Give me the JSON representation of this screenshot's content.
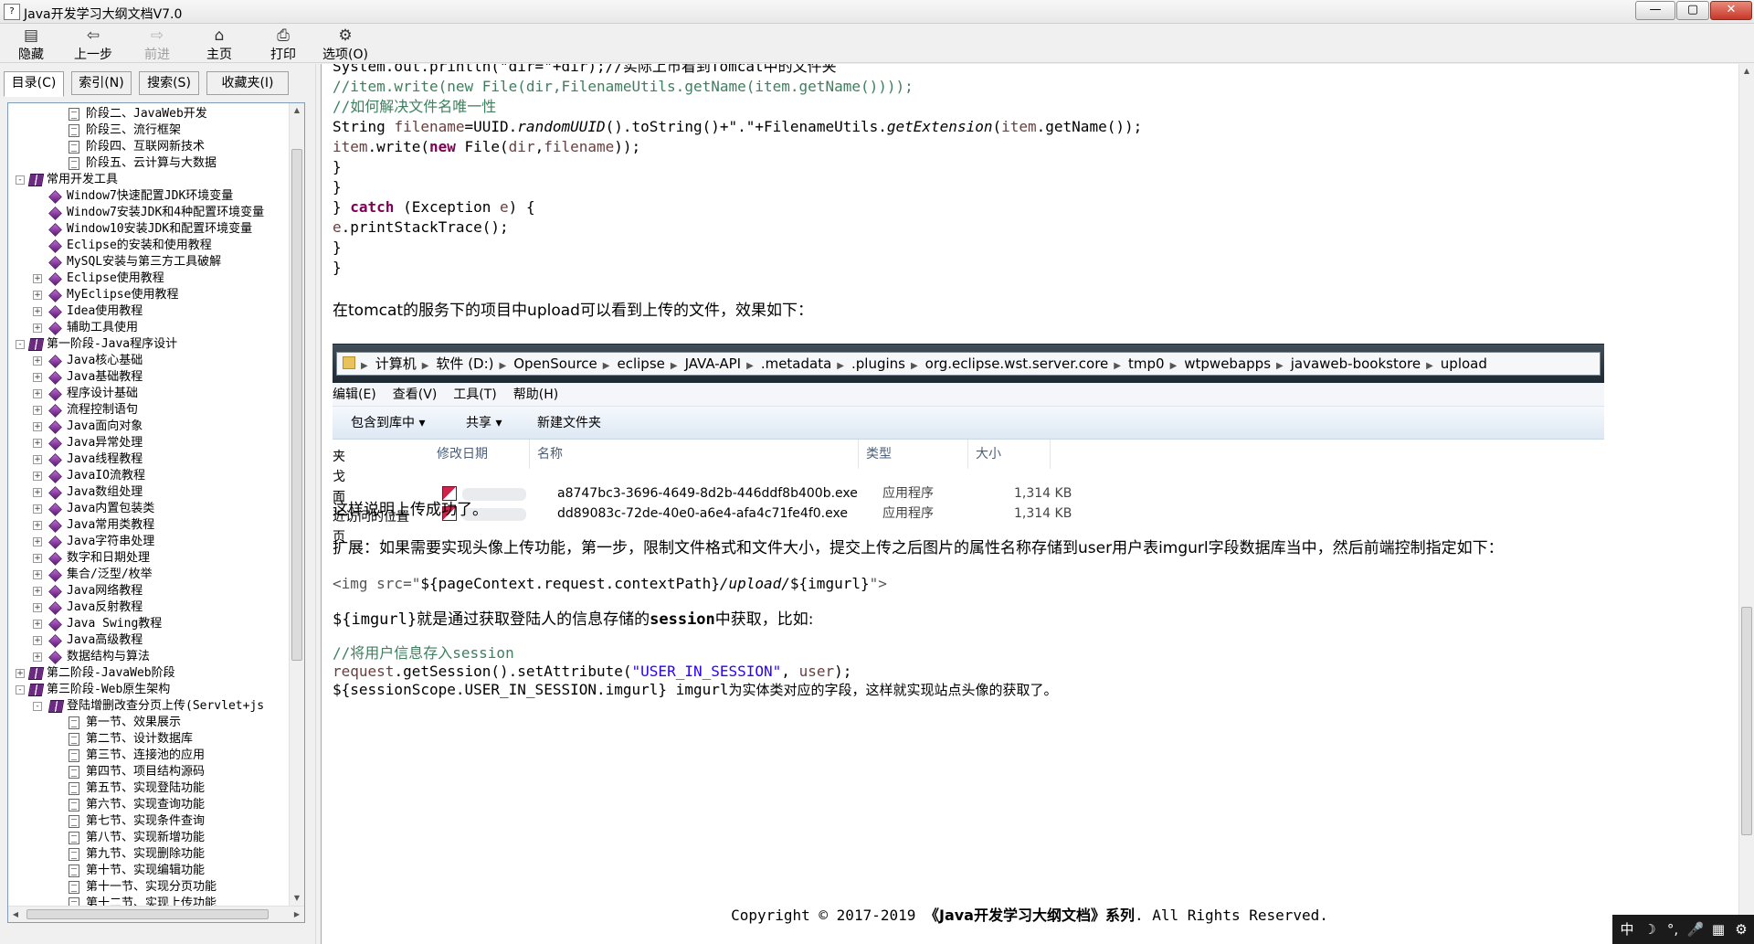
{
  "window": {
    "title": "Java开发学习大纲文档V7.0",
    "min": "—",
    "max": "▢",
    "close": "✕"
  },
  "toolbar": [
    {
      "label": "隐藏",
      "icon": "hide-icon",
      "glyph": "▤",
      "disabled": false
    },
    {
      "label": "上一步",
      "icon": "back-icon",
      "glyph": "⇦",
      "disabled": false
    },
    {
      "label": "前进",
      "icon": "forward-icon",
      "glyph": "⇨",
      "disabled": true
    },
    {
      "label": "主页",
      "icon": "home-icon",
      "glyph": "⌂",
      "disabled": false
    },
    {
      "label": "打印",
      "icon": "print-icon",
      "glyph": "⎙",
      "disabled": false
    },
    {
      "label": "选项(O)",
      "icon": "options-icon",
      "glyph": "⚙",
      "disabled": false
    }
  ],
  "tabs": [
    "目录(C)",
    "索引(N)",
    "搜索(S)",
    "收藏夹(I)"
  ],
  "tree": [
    {
      "level": 2,
      "icon": "doc",
      "label": "阶段二、JavaWeb开发"
    },
    {
      "level": 2,
      "icon": "doc",
      "label": "阶段三、流行框架"
    },
    {
      "level": 2,
      "icon": "doc",
      "label": "阶段四、互联网新技术"
    },
    {
      "level": 2,
      "icon": "doc",
      "label": "阶段五、云计算与大数据"
    },
    {
      "level": 0,
      "icon": "book",
      "expander": "-",
      "label": "常用开发工具"
    },
    {
      "level": 1,
      "icon": "gem",
      "label": "Window7快速配置JDK环境变量"
    },
    {
      "level": 1,
      "icon": "gem",
      "label": "Window7安装JDK和4种配置环境变量"
    },
    {
      "level": 1,
      "icon": "gem",
      "label": "Window10安装JDK和配置环境变量"
    },
    {
      "level": 1,
      "icon": "gem",
      "label": "Eclipse的安装和使用教程"
    },
    {
      "level": 1,
      "icon": "gem",
      "label": "MySQL安装与第三方工具破解"
    },
    {
      "level": 1,
      "icon": "gem",
      "expander": "+",
      "label": "Eclipse使用教程"
    },
    {
      "level": 1,
      "icon": "gem",
      "expander": "+",
      "label": "MyEclipse使用教程"
    },
    {
      "level": 1,
      "icon": "gem",
      "expander": "+",
      "label": "Idea使用教程"
    },
    {
      "level": 1,
      "icon": "gem",
      "expander": "+",
      "label": "辅助工具使用"
    },
    {
      "level": 0,
      "icon": "book",
      "expander": "-",
      "label": "第一阶段-Java程序设计"
    },
    {
      "level": 1,
      "icon": "gem",
      "expander": "+",
      "label": "Java核心基础"
    },
    {
      "level": 1,
      "icon": "gem",
      "expander": "+",
      "label": "Java基础教程"
    },
    {
      "level": 1,
      "icon": "gem",
      "expander": "+",
      "label": "程序设计基础"
    },
    {
      "level": 1,
      "icon": "gem",
      "expander": "+",
      "label": "流程控制语句"
    },
    {
      "level": 1,
      "icon": "gem",
      "expander": "+",
      "label": "Java面向对象"
    },
    {
      "level": 1,
      "icon": "gem",
      "expander": "+",
      "label": "Java异常处理"
    },
    {
      "level": 1,
      "icon": "gem",
      "expander": "+",
      "label": "Java线程教程"
    },
    {
      "level": 1,
      "icon": "gem",
      "expander": "+",
      "label": "JavaIO流教程"
    },
    {
      "level": 1,
      "icon": "gem",
      "expander": "+",
      "label": "Java数组处理"
    },
    {
      "level": 1,
      "icon": "gem",
      "expander": "+",
      "label": "Java内置包装类"
    },
    {
      "level": 1,
      "icon": "gem",
      "expander": "+",
      "label": "Java常用类教程"
    },
    {
      "level": 1,
      "icon": "gem",
      "expander": "+",
      "label": "Java字符串处理"
    },
    {
      "level": 1,
      "icon": "gem",
      "expander": "+",
      "label": "数字和日期处理"
    },
    {
      "level": 1,
      "icon": "gem",
      "expander": "+",
      "label": "集合/泛型/枚举"
    },
    {
      "level": 1,
      "icon": "gem",
      "expander": "+",
      "label": "Java网络教程"
    },
    {
      "level": 1,
      "icon": "gem",
      "expander": "+",
      "label": "Java反射教程"
    },
    {
      "level": 1,
      "icon": "gem",
      "expander": "+",
      "label": "Java Swing教程"
    },
    {
      "level": 1,
      "icon": "gem",
      "expander": "+",
      "label": "Java高级教程"
    },
    {
      "level": 1,
      "icon": "gem",
      "expander": "+",
      "label": "数据结构与算法"
    },
    {
      "level": 0,
      "icon": "book",
      "expander": "+",
      "label": "第二阶段-JavaWeb阶段"
    },
    {
      "level": 0,
      "icon": "book",
      "expander": "-",
      "label": "第三阶段-Web原生架构"
    },
    {
      "level": 1,
      "icon": "book",
      "expander": "-",
      "label": "登陆增删改查分页上传(Servlet+js"
    },
    {
      "level": 2,
      "icon": "doc",
      "label": "第一节、效果展示"
    },
    {
      "level": 2,
      "icon": "doc",
      "label": "第二节、设计数据库"
    },
    {
      "level": 2,
      "icon": "doc",
      "label": "第三节、连接池的应用"
    },
    {
      "level": 2,
      "icon": "doc",
      "label": "第四节、项目结构源码"
    },
    {
      "level": 2,
      "icon": "doc",
      "label": "第五节、实现登陆功能"
    },
    {
      "level": 2,
      "icon": "doc",
      "label": "第六节、实现查询功能"
    },
    {
      "level": 2,
      "icon": "doc",
      "label": "第七节、实现条件查询"
    },
    {
      "level": 2,
      "icon": "doc",
      "label": "第八节、实现新增功能"
    },
    {
      "level": 2,
      "icon": "doc",
      "label": "第九节、实现删除功能"
    },
    {
      "level": 2,
      "icon": "doc",
      "label": "第十节、实现编辑功能"
    },
    {
      "level": 2,
      "icon": "doc",
      "label": "第十一节、实现分页功能"
    },
    {
      "level": 2,
      "icon": "doc",
      "label": "第十二节、实现上传功能"
    }
  ],
  "code_top": {
    "line0": "System.out.println(\"dir=\"+dir);//实际上市看到Tomcat中的文件夹",
    "line1": "//item.write(new File(dir,FilenameUtils.getName(item.getName())));",
    "line2": "//如何解决文件名唯一性",
    "line3_a": "String ",
    "line3_b": "filename",
    "line3_c": "=UUID.",
    "line3_d": "randomUUID",
    "line3_e": "().toString()+\".\"+FilenameUtils.",
    "line3_f": "getExtension",
    "line3_g": "(",
    "line3_h": "item",
    "line3_i": ".getName());",
    "line4_a": "item",
    "line4_b": ".write(",
    "line4_c": "new",
    "line4_d": " File(",
    "line4_e": "dir",
    "line4_f": ",",
    "line4_g": "filename",
    "line4_h": "));",
    "line5": "}",
    "line6": "}",
    "line7_a": "} ",
    "line7_b": "catch",
    "line7_c": " (Exception ",
    "line7_d": "e",
    "line7_e": ") {",
    "line8_a": "e",
    "line8_b": ".printStackTrace();",
    "line9": "}",
    "line10": "}"
  },
  "text": {
    "p1": "在tomcat的服务下的项目中upload可以看到上传的文件，效果如下：",
    "p2": "这样说明上传成功了。",
    "p3": "扩展：如果需要实现头像上传功能，第一步，限制文件格式和文件大小，提交上传之后图片的属性名称存储到user用户表imgurl字段数据库当中，然后前端控制指定如下：",
    "img_a": "<img src=\"",
    "img_b": "${pageContext.request.contextPath}",
    "img_c": "/upload/",
    "img_d": "${imgurl}",
    "img_e": "\">",
    "p4_a": "${imgurl}",
    "p4_b": "就是通过获取登陆人的信息存储的",
    "p4_c": "session",
    "p4_d": "中获取，比如:",
    "c1": "//将用户信息存入session",
    "c2_a": "request",
    "c2_b": ".getSession().setAttribute(",
    "c2_c": "\"USER_IN_SESSION\"",
    "c2_d": ", ",
    "c2_e": "user",
    "c2_f": ");",
    "c3_a": "${sessionScope.USER_IN_SESSION.imgurl} imgurl",
    "c3_b": "为实体类对应的字段，这样就实现站点头像的获取了。",
    "copyright_a": "Copyright © 2017-2019 ",
    "copyright_b": "《Java开发学习大纲文档》系列",
    "copyright_c": ". All Rights Reserved."
  },
  "explorer": {
    "breadcrumbs": [
      "计算机",
      "软件 (D:)",
      "OpenSource",
      "eclipse",
      "JAVA-API",
      ".metadata",
      ".plugins",
      "org.eclipse.wst.server.core",
      "tmp0",
      "wtpwebapps",
      "javaweb-bookstore",
      "upload"
    ],
    "menu": [
      "编辑(E)",
      "查看(V)",
      "工具(T)",
      "帮助(H)"
    ],
    "tools": [
      "包含到库中 ▾",
      "共享 ▾",
      "新建文件夹"
    ],
    "columns": [
      "修改日期",
      "名称",
      "类型",
      "大小"
    ],
    "nav": [
      "夹",
      "戈",
      "面",
      "近访问的位置",
      "页"
    ],
    "files": [
      {
        "name": "a8747bc3-3696-4649-8d2b-446ddf8b400b.exe",
        "type": "应用程序",
        "size": "1,314 KB"
      },
      {
        "name": "dd89083c-72de-40e0-a6e4-afa4c71fe4f0.exe",
        "type": "应用程序",
        "size": "1,314 KB"
      }
    ]
  },
  "ime": [
    "中",
    "☽",
    "°,",
    "🎤",
    "▦",
    "⚙"
  ]
}
